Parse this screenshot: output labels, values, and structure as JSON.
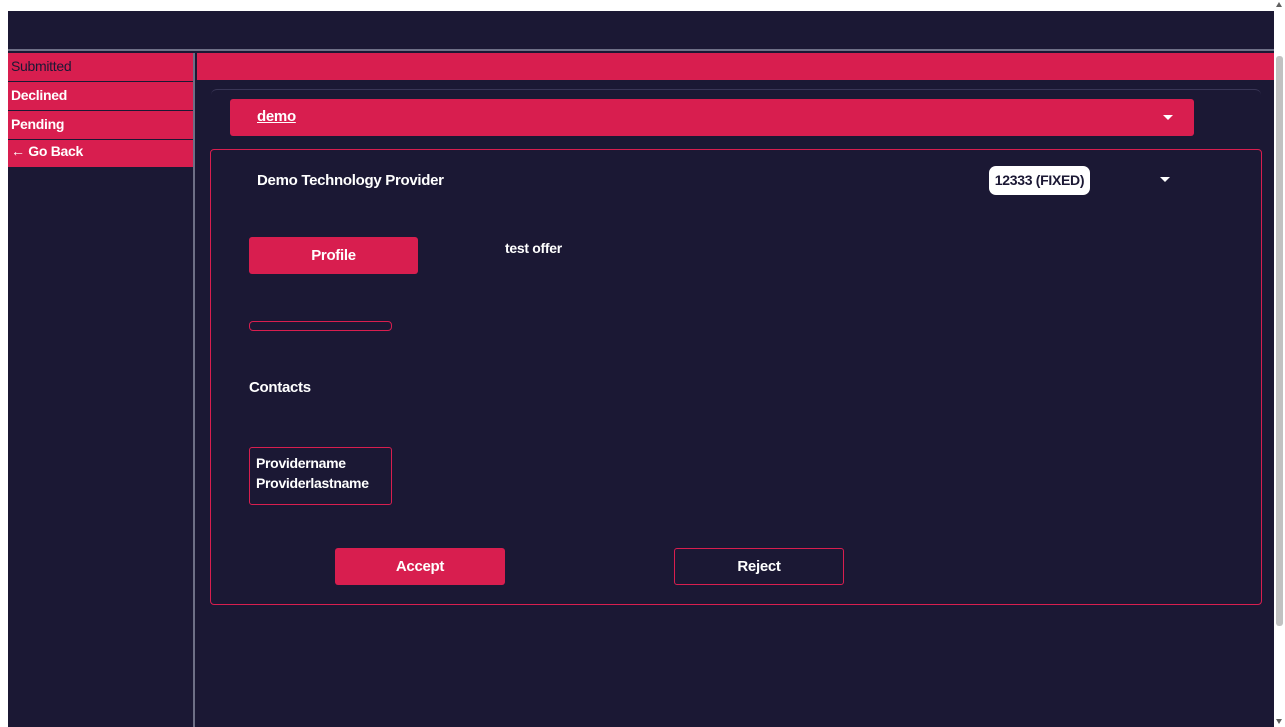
{
  "sidebar": {
    "items": [
      {
        "label": "Submitted"
      },
      {
        "label": "Declined"
      },
      {
        "label": "Pending"
      },
      {
        "label": "← Go Back"
      }
    ]
  },
  "project_select": {
    "value": "demo"
  },
  "offer": {
    "provider": "Demo Technology Provider",
    "price": "12333 (FIXED)",
    "profile_label": "Profile",
    "title": "test offer",
    "contacts_label": "Contacts",
    "contact": {
      "first_name": "Providername",
      "last_name": "Providerlastname"
    },
    "accept_label": "Accept",
    "reject_label": "Reject"
  },
  "colors": {
    "background": "#1b1834",
    "accent": "#d81e4f",
    "divider": "#6e6f86"
  },
  "icons": {
    "select_caret": "caret-down-icon",
    "price_caret": "caret-down-icon"
  }
}
